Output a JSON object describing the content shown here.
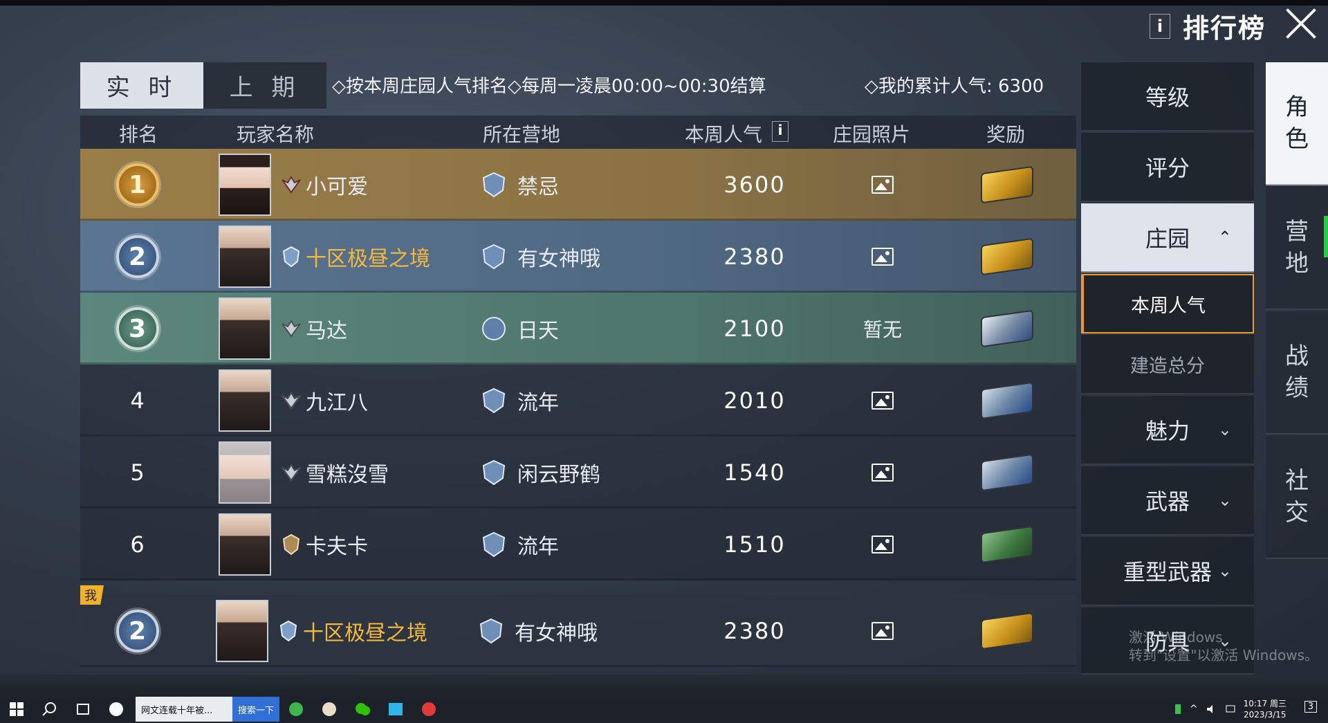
{
  "header": {
    "title": "排行榜",
    "info": "i"
  },
  "tabs": {
    "realtime": "实 时",
    "previous": "上 期"
  },
  "rules": "◇按本周庄园人气排名◇每周一凌晨00:00~00:30结算",
  "my_total": "◇我的累计人气: 6300",
  "columns": {
    "rank": "排名",
    "player": "玩家名称",
    "camp": "所在营地",
    "popularity": "本周人气",
    "info": "i",
    "photo": "庄园照片",
    "reward": "奖励"
  },
  "rows": [
    {
      "rank": "1",
      "name": "小可爱",
      "camp": "禁忌",
      "popularity": "3600",
      "photo": "",
      "reward": "gold-chest"
    },
    {
      "rank": "2",
      "name": "十区极昼之境",
      "camp": "有女神哦",
      "popularity": "2380",
      "photo": "",
      "reward": "gold-chest"
    },
    {
      "rank": "3",
      "name": "马达",
      "camp": "日天",
      "popularity": "2100",
      "photo": "暂无",
      "reward": "silver-chest"
    },
    {
      "rank": "4",
      "name": "九江八",
      "camp": "流年",
      "popularity": "2010",
      "photo": "",
      "reward": "blue-chest"
    },
    {
      "rank": "5",
      "name": "雪糕沒雪",
      "camp": "闲云野鹤",
      "popularity": "1540",
      "photo": "",
      "reward": "blue-chest"
    },
    {
      "rank": "6",
      "name": "卡夫卡",
      "camp": "流年",
      "popularity": "1510",
      "photo": "",
      "reward": "green-chest"
    }
  ],
  "me": {
    "tag": "我",
    "rank": "2",
    "name": "十区极昼之境",
    "camp": "有女神哦",
    "popularity": "2380"
  },
  "menu": {
    "level": "等级",
    "score": "评分",
    "manor": "庄园",
    "weekly": "本周人气",
    "build": "建造总分",
    "charm": "魅力",
    "weapon": "武器",
    "heavy": "重型武器",
    "armor": "防具"
  },
  "side": {
    "role": "角\n色",
    "camp": "营\n地",
    "record": "战\n绩",
    "social": "社\n交"
  },
  "watermark": {
    "line1": "激活 Windows",
    "line2": "转到\"设置\"以激活 Windows。"
  },
  "taskbar": {
    "task": "网文连载十年被...",
    "search": "搜索一下",
    "time": "10:17 周三",
    "date": "2023/3/15",
    "notif": "3"
  },
  "colors": {
    "gold": "#f5b93a",
    "accent": "#f09a2a"
  }
}
